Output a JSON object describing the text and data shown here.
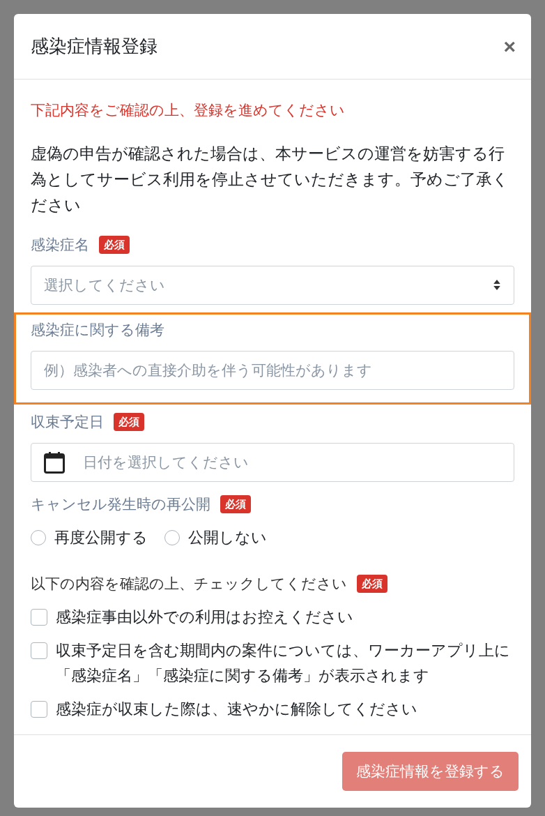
{
  "dialog": {
    "title": "感染症情報登録",
    "close": "×"
  },
  "notice": "下記内容をご確認の上、登録を進めてください",
  "description": "虚偽の申告が確認された場合は、本サービスの運営を妨害する行為としてサービス利用を停止させていただきます。予めご了承ください",
  "fields": [
    {
      "kind": "select",
      "label": "感染症名",
      "required": true,
      "badge": "必須",
      "placeholder": "選択してください"
    },
    {
      "kind": "text",
      "label": "感染症に関する備考",
      "required": false,
      "placeholder": "例）感染者への直接介助を伴う可能性があります",
      "highlighted": true
    },
    {
      "kind": "date",
      "label": "収束予定日",
      "required": true,
      "badge": "必須",
      "placeholder": "日付を選択してください"
    },
    {
      "kind": "radio",
      "label": "キャンセル発生時の再公開",
      "required": true,
      "badge": "必須",
      "options": [
        {
          "label": "再度公開する",
          "selected": false
        },
        {
          "label": "公開しない",
          "selected": false
        }
      ]
    },
    {
      "kind": "checks",
      "label": "以下の内容を確認の上、チェックしてください",
      "required": true,
      "badge": "必須",
      "options": [
        {
          "label": "感染症事由以外での利用はお控えください",
          "checked": false
        },
        {
          "label": "収束予定日を含む期間内の案件については、ワーカーアプリ上に「感染症名」「感染症に関する備考」が表示されます",
          "checked": false
        },
        {
          "label": "感染症が収束した際は、速やかに解除してください",
          "checked": false
        }
      ]
    }
  ],
  "submit": {
    "label": "感染症情報を登録する",
    "disabled": true
  }
}
